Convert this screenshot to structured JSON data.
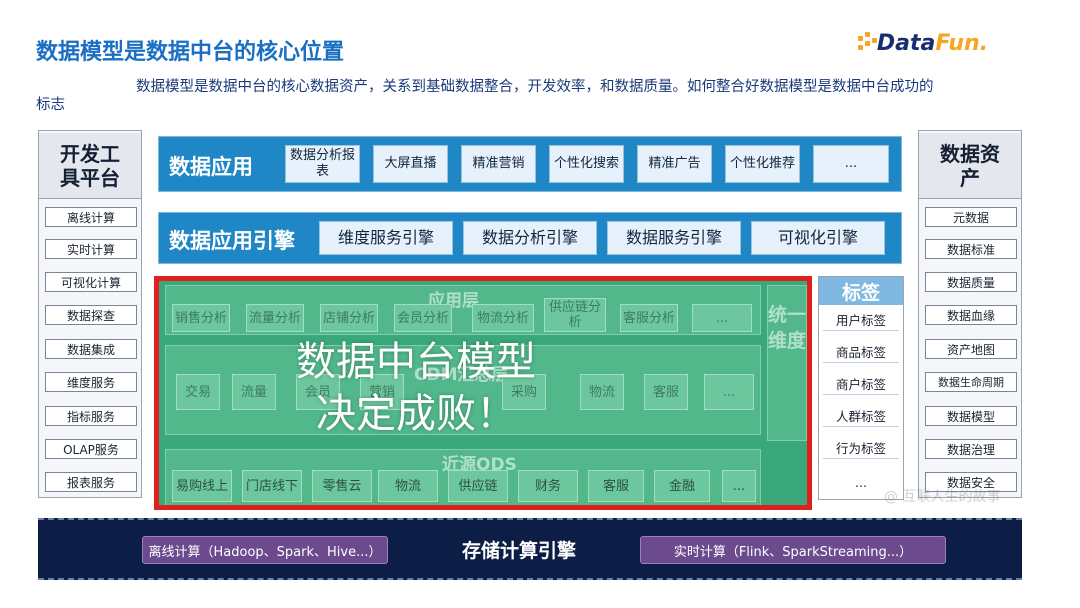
{
  "title": "数据模型是数据中台的核心位置",
  "logo": {
    "text_a": "Data",
    "text_b": "Fun."
  },
  "description": "数据模型是数据中台的核心数据资产，关系到基础数据整合，开发效率，和数据质量。如何整合好数据模型是数据中台成功的标志",
  "diagram": {
    "left_column": {
      "title": "开发工具平台",
      "items": [
        "离线计算",
        "实时计算",
        "可视化计算",
        "数据探查",
        "数据集成",
        "维度服务",
        "指标服务",
        "OLAP服务",
        "报表服务"
      ]
    },
    "right_column": {
      "title": "数据资产",
      "items": [
        "元数据",
        "数据标准",
        "数据质量",
        "数据血缘",
        "资产地图",
        "数据生命周期",
        "数据模型",
        "数据治理",
        "数据安全"
      ]
    },
    "data_app": {
      "label": "数据应用",
      "items": [
        "数据分析报表",
        "大屏直播",
        "精准营销",
        "个性化搜索",
        "精准广告",
        "个性化推荐",
        "..."
      ]
    },
    "data_app_engine": {
      "label": "数据应用引擎",
      "items": [
        "维度服务引擎",
        "数据分析引擎",
        "数据服务引擎",
        "可视化引擎"
      ]
    },
    "core": {
      "layer_app": {
        "label": "应用层",
        "items": [
          "销售分析",
          "流量分析",
          "店铺分析",
          "会员分析",
          "物流分析",
          "供应链分析",
          "客服分析",
          "..."
        ]
      },
      "layer_mid": {
        "label": "CDM汇总层",
        "items": [
          "交易",
          "流量",
          "会员",
          "营销",
          "采购",
          "物流",
          "客服",
          "..."
        ]
      },
      "layer_ods": {
        "label": "近源ODS",
        "items": [
          "易购线上",
          "门店线下",
          "零售云",
          "物流",
          "供应链",
          "财务",
          "客服",
          "金融",
          "..."
        ]
      },
      "unified_dimension": "统一维度",
      "overlay_line1": "数据中台模型",
      "overlay_line2": "决定成败！"
    },
    "tags": {
      "title": "标签",
      "items": [
        "用户标签",
        "商品标签",
        "商户标签",
        "人群标签",
        "行为标签",
        "..."
      ]
    },
    "storage": {
      "label": "存储计算引擎",
      "left": "离线计算（Hadoop、Spark、Hive...）",
      "right": "实时计算（Flink、SparkStreaming...）"
    },
    "watermark": "@ 互联人生的故事"
  },
  "colors": {
    "title_blue": "#1a6fc4",
    "band_blue": "#1f87c6",
    "core_green": "#3aa87a",
    "highlight_red": "#e0201c",
    "storage_navy": "#0c1d46",
    "pill_purple": "#6b4a8e",
    "logo_orange": "#f5a623"
  }
}
